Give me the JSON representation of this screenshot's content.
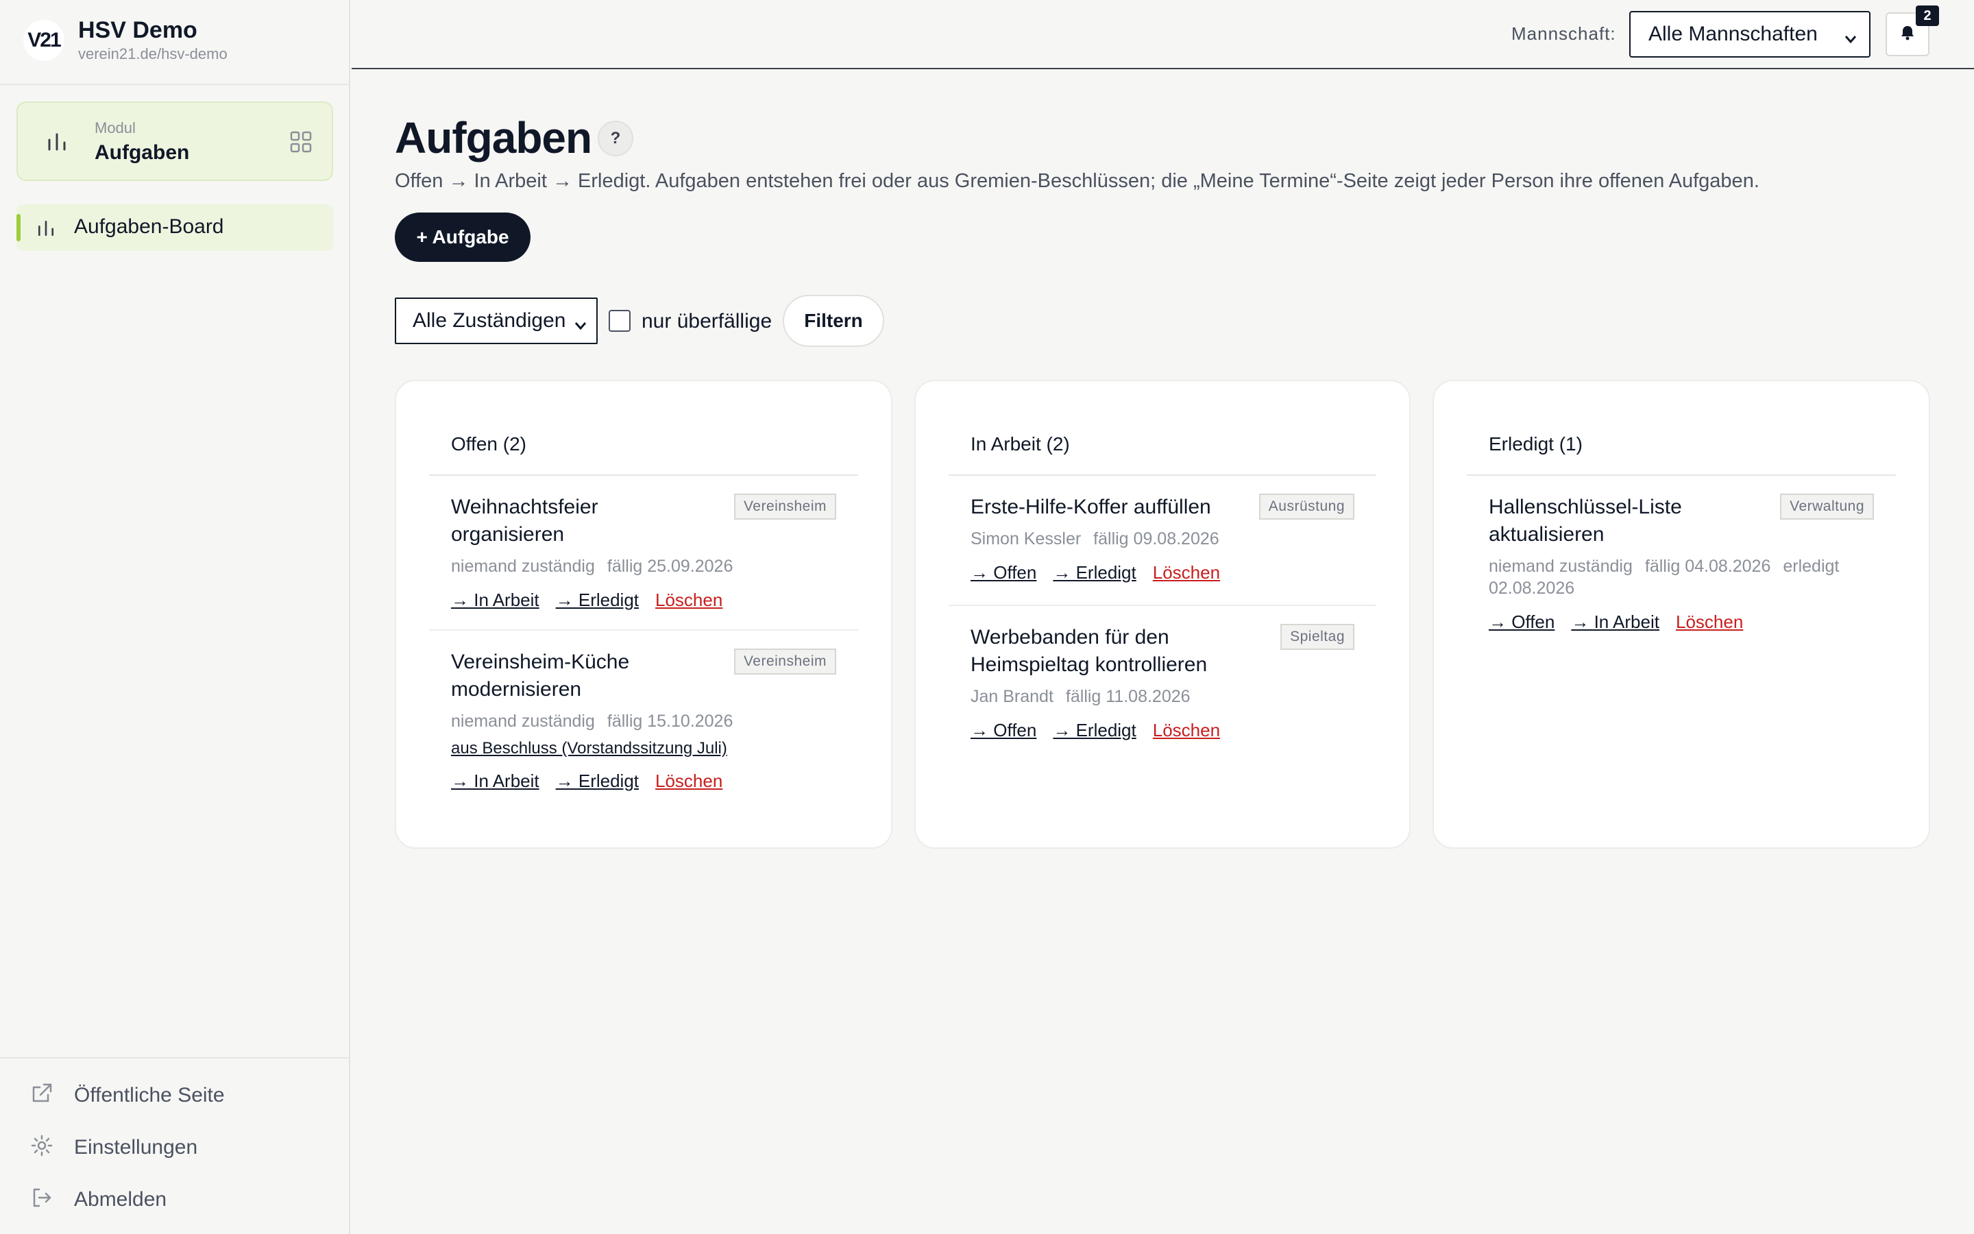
{
  "brand": {
    "logo": "V21",
    "name": "HSV Demo",
    "url": "verein21.de/hsv-demo"
  },
  "module": {
    "caption": "Modul",
    "title": "Aufgaben",
    "icon": "bar-chart-icon"
  },
  "nav": {
    "items": [
      {
        "label": "Aufgaben-Board",
        "icon": "bar-chart-icon"
      }
    ]
  },
  "footer": {
    "public_page": "Öffentliche Seite",
    "settings": "Einstellungen",
    "logout": "Abmelden"
  },
  "topbar": {
    "team_label": "Mannschaft:",
    "team_selected": "Alle Mannschaften",
    "notification_count": "2"
  },
  "page": {
    "title": "Aufgaben",
    "help": "?",
    "description": "Offen → In Arbeit → Erledigt. Aufgaben entstehen frei oder aus Gremien-Beschlüssen; die „Meine Termine“-Seite zeigt jeder Person ihre offenen Aufgaben.",
    "add_button": "+ Aufgabe"
  },
  "filters": {
    "assignee_selected": "Alle Zuständigen",
    "overdue_label": "nur überfällige",
    "overdue_checked": false,
    "filter_button": "Filtern"
  },
  "columns": [
    {
      "header": "Offen (2)",
      "tasks": [
        {
          "title": "Weihnachtsfeier organisieren",
          "tag": "Vereinsheim",
          "assignee": "niemand zuständig",
          "due": "fällig 25.09.2026",
          "actions": [
            "→ In Arbeit",
            "→ Erledigt"
          ],
          "delete": "Löschen"
        },
        {
          "title": "Vereinsheim-Küche modernisieren",
          "tag": "Vereinsheim",
          "assignee": "niemand zuständig",
          "due": "fällig 15.10.2026",
          "source": "aus Beschluss (Vorstandssitzung Juli)",
          "actions": [
            "→ In Arbeit",
            "→ Erledigt"
          ],
          "delete": "Löschen"
        }
      ]
    },
    {
      "header": "In Arbeit (2)",
      "tasks": [
        {
          "title": "Erste-Hilfe-Koffer auffüllen",
          "tag": "Ausrüstung",
          "assignee": "Simon Kessler",
          "due": "fällig 09.08.2026",
          "actions": [
            "→ Offen",
            "→ Erledigt"
          ],
          "delete": "Löschen"
        },
        {
          "title": "Werbebanden für den Heimspieltag kontrollieren",
          "tag": "Spieltag",
          "assignee": "Jan Brandt",
          "due": "fällig 11.08.2026",
          "actions": [
            "→ Offen",
            "→ Erledigt"
          ],
          "delete": "Löschen"
        }
      ]
    },
    {
      "header": "Erledigt (1)",
      "tasks": [
        {
          "title": "Hallenschlüssel-Liste aktualisieren",
          "tag": "Verwaltung",
          "assignee": "niemand zuständig",
          "due": "fällig 04.08.2026",
          "done": "erledigt 02.08.2026",
          "actions": [
            "→ Offen",
            "→ In Arbeit"
          ],
          "delete": "Löschen"
        }
      ]
    }
  ],
  "colors": {
    "accent": "#9ccc3d",
    "accent_bg": "#eef5df",
    "primary": "#101828",
    "danger": "#c81e1e"
  }
}
